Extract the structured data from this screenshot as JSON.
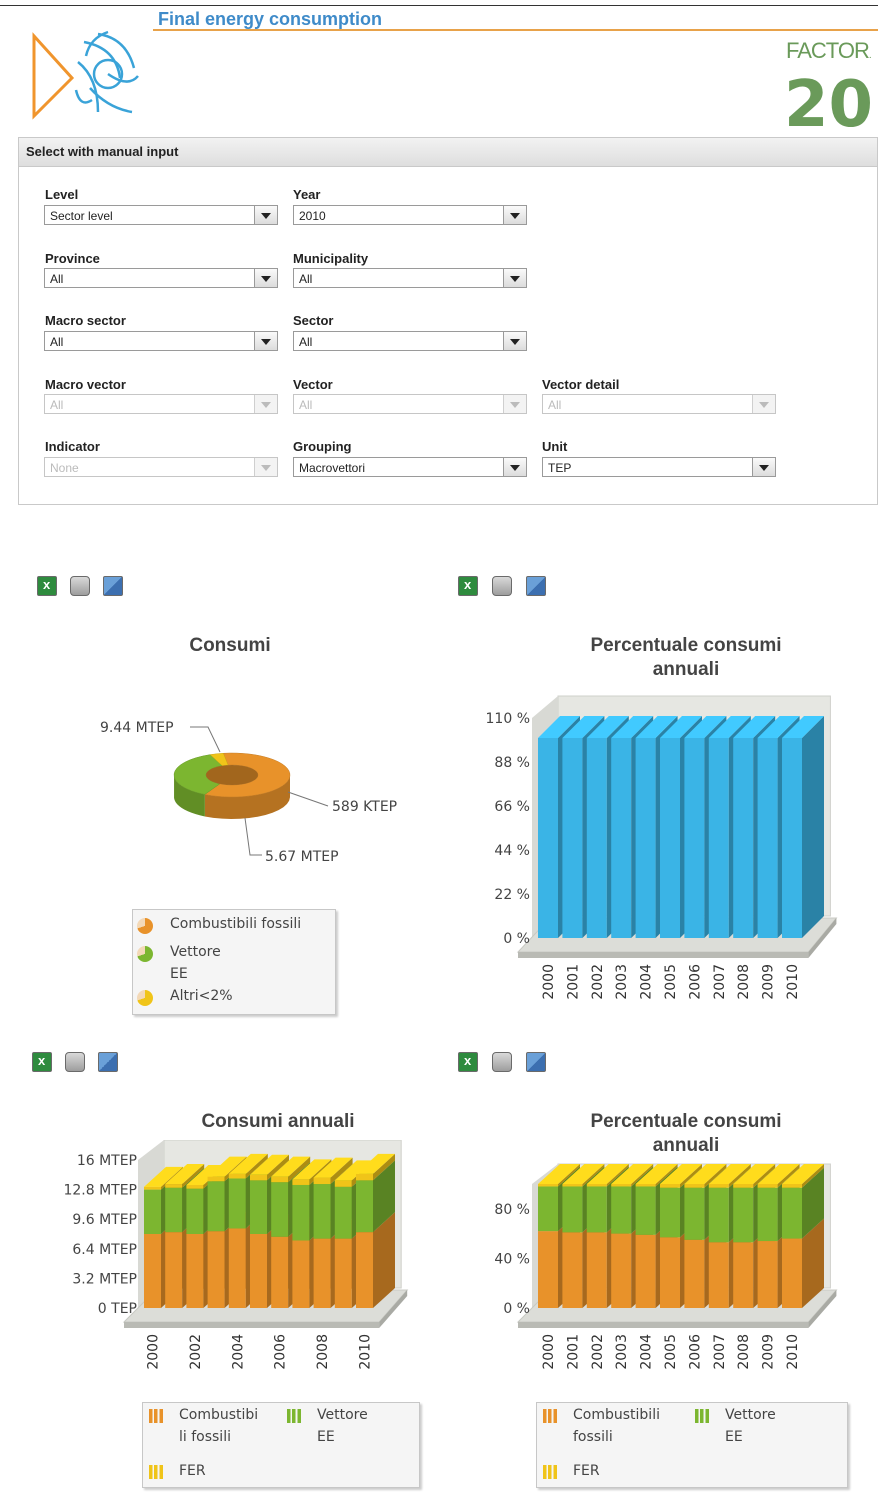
{
  "header": {
    "title": "Final energy consumption",
    "logo_right_text": "FACTOR",
    "logo_right_number": "20"
  },
  "panel": {
    "title": "Select with manual input",
    "fields": [
      {
        "label": "Level",
        "value": "Sector level",
        "disabled": false
      },
      {
        "label": "Year",
        "value": "2010",
        "disabled": false
      },
      {
        "label": "Province",
        "value": "All",
        "disabled": false
      },
      {
        "label": "Municipality",
        "value": "All",
        "disabled": false
      },
      {
        "label": "Macro sector",
        "value": "All",
        "disabled": false
      },
      {
        "label": "Sector",
        "value": "All",
        "disabled": false
      },
      {
        "label": "Macro vector",
        "value": "All",
        "disabled": true
      },
      {
        "label": "Vector",
        "value": "All",
        "disabled": true
      },
      {
        "label": "Vector detail",
        "value": "All",
        "disabled": true
      },
      {
        "label": "Indicator",
        "value": "None",
        "disabled": true
      },
      {
        "label": "Grouping",
        "value": "Macrovettori",
        "disabled": false
      },
      {
        "label": "Unit",
        "value": "TEP",
        "disabled": false
      }
    ]
  },
  "colors": {
    "orange": "#e8922a",
    "green": "#7cb630",
    "yellow": "#f0c419",
    "blue": "#3ab4e6"
  },
  "chart_data": [
    {
      "type": "pie",
      "title": "Consumi",
      "slices": [
        {
          "label": "Combustibili fossili",
          "value": 9.44,
          "unit": "MTEP",
          "value_label": "9.44 MTEP"
        },
        {
          "label": "Vettore EE",
          "value": 5.67,
          "unit": "MTEP",
          "value_label": "5.67 MTEP"
        },
        {
          "label": "Altri<2%",
          "value": 0.589,
          "unit": "MTEP",
          "value_label": "589 KTEP"
        }
      ],
      "legend": [
        {
          "line1": "Combustibili fossili",
          "line2": ""
        },
        {
          "line1": "Vettore",
          "line2": "EE"
        },
        {
          "line1": "Altri<2%",
          "line2": ""
        }
      ],
      "legend_position": "bottom"
    },
    {
      "type": "bar",
      "title": "Percentuale consumi annuali",
      "categories": [
        "2000",
        "2001",
        "2002",
        "2003",
        "2004",
        "2005",
        "2006",
        "2007",
        "2008",
        "2009",
        "2010"
      ],
      "series": [
        {
          "values": [
            100,
            100,
            100,
            100,
            100,
            100,
            100,
            100,
            100,
            100,
            100
          ]
        }
      ],
      "yticks": [
        "0 %",
        "22 %",
        "44 %",
        "66 %",
        "88 %",
        "110 %"
      ],
      "ylim": [
        0,
        110
      ],
      "grid": false
    },
    {
      "type": "bar",
      "title": "Consumi annuali",
      "categories": [
        "2000",
        "2001",
        "2002",
        "2003",
        "2004",
        "2005",
        "2006",
        "2007",
        "2008",
        "2009",
        "2010"
      ],
      "xtick_labels": [
        "2000",
        "2002",
        "2004",
        "2006",
        "2008",
        "2010"
      ],
      "series": [
        {
          "name": "Combustibili fossili",
          "values": [
            8.0,
            8.2,
            8.0,
            8.3,
            8.6,
            8.0,
            7.7,
            7.3,
            7.5,
            7.5,
            8.2
          ]
        },
        {
          "name": "Vettore EE",
          "values": [
            4.8,
            4.8,
            4.9,
            5.4,
            5.4,
            5.8,
            5.9,
            6.0,
            5.9,
            5.6,
            5.6
          ]
        },
        {
          "name": "FER",
          "values": [
            0.3,
            0.4,
            0.4,
            0.5,
            0.5,
            0.6,
            0.6,
            0.6,
            0.7,
            0.7,
            0.7
          ]
        }
      ],
      "yticks": [
        "0 TEP",
        "3.2 MTEP",
        "6.4 MTEP",
        "9.6 MTEP",
        "12.8 MTEP",
        "16 MTEP"
      ],
      "ylim": [
        0,
        16
      ],
      "stacked": true,
      "legend": [
        {
          "line1": "Combustibi",
          "line2": "li fossili"
        },
        {
          "line1": "Vettore",
          "line2": "EE"
        },
        {
          "line1": "FER",
          "line2": ""
        }
      ]
    },
    {
      "type": "bar",
      "title": "Percentuale consumi annuali",
      "categories": [
        "2000",
        "2001",
        "2002",
        "2003",
        "2004",
        "2005",
        "2006",
        "2007",
        "2008",
        "2009",
        "2010"
      ],
      "series": [
        {
          "name": "Combustibili fossili",
          "values": [
            62,
            61,
            61,
            60,
            59,
            57,
            55,
            53,
            53,
            54,
            56
          ]
        },
        {
          "name": "Vettore EE",
          "values": [
            36,
            37,
            37,
            38,
            39,
            40,
            42,
            44,
            44,
            43,
            41
          ]
        },
        {
          "name": "FER",
          "values": [
            2,
            2,
            2,
            2,
            2,
            3,
            3,
            3,
            3,
            3,
            3
          ]
        }
      ],
      "yticks": [
        "0 %",
        "40 %",
        "80 %"
      ],
      "ylim": [
        0,
        100
      ],
      "stacked": true,
      "legend": [
        {
          "line1": "Combustibili",
          "line2": "fossili"
        },
        {
          "line1": "Vettore",
          "line2": "EE"
        },
        {
          "line1": "FER",
          "line2": ""
        }
      ]
    }
  ]
}
